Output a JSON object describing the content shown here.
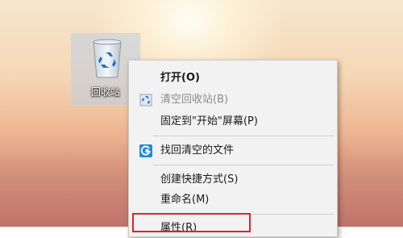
{
  "desktop": {
    "recycle_bin": {
      "label": "回收站"
    }
  },
  "context_menu": {
    "items": [
      {
        "label": "打开(O)"
      },
      {
        "label": "清空回收站(B)"
      },
      {
        "label": "固定到\"开始\"屏幕(P)"
      },
      {
        "label": "找回清空的文件"
      },
      {
        "label": "创建快捷方式(S)"
      },
      {
        "label": "重命名(M)"
      },
      {
        "label": "属性(R)"
      }
    ]
  },
  "colors": {
    "highlight_border": "#e0231f",
    "recovery_icon": "#1e88e5"
  }
}
